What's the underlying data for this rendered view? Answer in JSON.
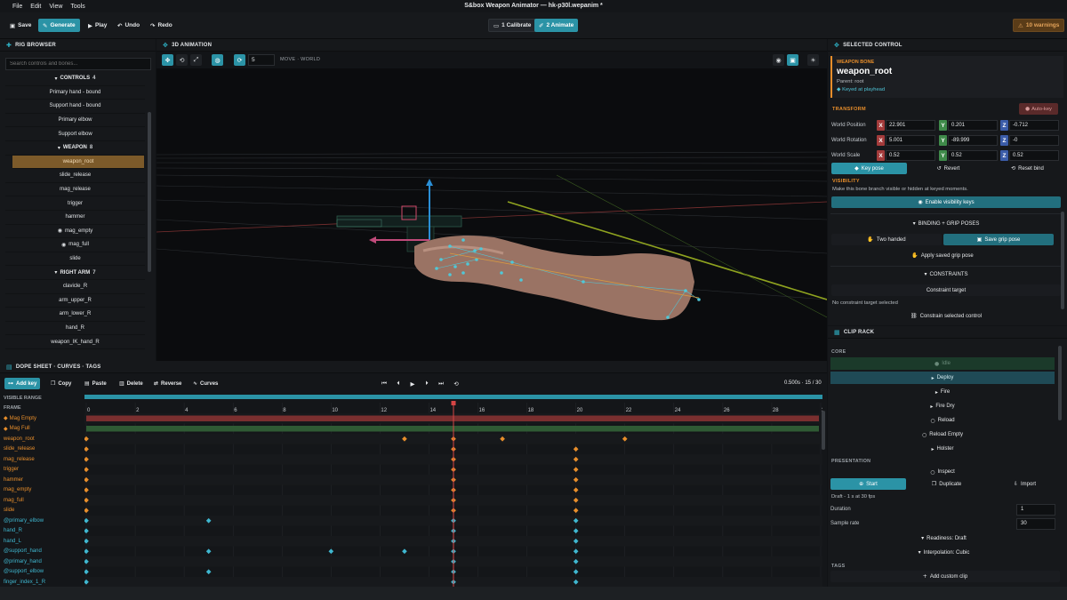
{
  "menu": [
    "File",
    "Edit",
    "View",
    "Tools"
  ],
  "window_title": "S&box Weapon Animator — hk-p30l.wepanim *",
  "toolbar": {
    "save": "Save",
    "generate": "Generate",
    "play": "Play",
    "undo": "Undo",
    "redo": "Redo",
    "calibrate": "1  Calibrate",
    "animate": "2  Animate",
    "warnings": "10 warnings"
  },
  "rig": {
    "title": "RIG BROWSER",
    "search_placeholder": "Search controls and bones...",
    "rows": [
      {
        "t": "group",
        "label": "CONTROLS",
        "count": "4"
      },
      {
        "t": "item",
        "label": "Primary hand - bound"
      },
      {
        "t": "item",
        "label": "Support hand - bound"
      },
      {
        "t": "item",
        "label": "Primary elbow"
      },
      {
        "t": "item",
        "label": "Support elbow"
      },
      {
        "t": "group",
        "label": "WEAPON",
        "count": "8"
      },
      {
        "t": "sel",
        "label": "weapon_root"
      },
      {
        "t": "item",
        "label": "slide_release"
      },
      {
        "t": "item",
        "label": "mag_release"
      },
      {
        "t": "item",
        "label": "trigger"
      },
      {
        "t": "item",
        "label": "hammer"
      },
      {
        "t": "eye",
        "label": "mag_empty"
      },
      {
        "t": "eye",
        "label": "mag_full"
      },
      {
        "t": "item",
        "label": "slide"
      },
      {
        "t": "group",
        "label": "RIGHT ARM",
        "count": "7"
      },
      {
        "t": "item",
        "label": "clavicle_R"
      },
      {
        "t": "item",
        "label": "arm_upper_R"
      },
      {
        "t": "item",
        "label": "arm_lower_R"
      },
      {
        "t": "item",
        "label": "hand_R"
      },
      {
        "t": "item",
        "label": "weapon_IK_hand_R"
      }
    ]
  },
  "viewport": {
    "title": "3D ANIMATION",
    "step": "5",
    "mode": "MOVE · WORLD"
  },
  "selected": {
    "title": "SELECTED CONTROL",
    "tag": "WEAPON BONE",
    "name": "weapon_root",
    "parent": "Parent: root",
    "keyed": "Keyed at playhead",
    "transform_label": "TRANSFORM",
    "autokey": "Auto-key",
    "rows": [
      {
        "label": "World Position",
        "x": "22.901",
        "y": "0.201",
        "z": "-0.712"
      },
      {
        "label": "World Rotation",
        "x": "5.001",
        "y": "-89.999",
        "z": "-0"
      },
      {
        "label": "World Scale",
        "x": "0.52",
        "y": "0.52",
        "z": "0.52"
      }
    ],
    "key_pose": "Key pose",
    "revert": "Revert",
    "reset_bind": "Reset bind",
    "visibility_label": "VISIBILITY",
    "visibility_desc": "Make this bone branch visible or hidden at keyed moments.",
    "enable_vis": "Enable visibility keys",
    "binding": "BINDING + GRIP POSES",
    "two_handed": "Two handed",
    "save_grip": "Save grip pose",
    "apply_grip": "Apply saved grip pose",
    "constraints": "CONSTRAINTS",
    "constraint_target": "Constraint target",
    "no_target": "No constraint target selected",
    "constrain": "Constrain selected control"
  },
  "cliprack": {
    "title": "CLIP RACK",
    "core": "CORE",
    "clips": [
      {
        "label": "Idle",
        "state": "disabled",
        "icon": "dot"
      },
      {
        "label": "Deploy",
        "state": "active",
        "icon": "chev"
      },
      {
        "label": "Fire",
        "state": "",
        "icon": "chev"
      },
      {
        "label": "Fire Dry",
        "state": "",
        "icon": "chev"
      },
      {
        "label": "Reload",
        "state": "",
        "icon": "ring"
      },
      {
        "label": "Reload Empty",
        "state": "",
        "icon": "ring"
      },
      {
        "label": "Holster",
        "state": "",
        "icon": "chev"
      }
    ],
    "presentation": "PRESENTATION",
    "inspect": "Inspect",
    "start": "Start",
    "duplicate": "Duplicate",
    "import": "Import",
    "draft": "Draft - 1 s at 30 fps",
    "duration_label": "Duration",
    "duration": "1",
    "sample_label": "Sample rate",
    "sample": "30",
    "readiness": "Readiness: Draft",
    "interpolation": "Interpolation: Cubic",
    "tags": "TAGS",
    "add_clip": "Add custom clip"
  },
  "dope": {
    "title": "DOPE SHEET · CURVES · TAGS",
    "add_key": "Add key",
    "copy": "Copy",
    "paste": "Paste",
    "delete": "Delete",
    "reverse": "Reverse",
    "curves": "Curves",
    "time": "0.500s · 15 / 30",
    "visible_range": "VISIBLE RANGE",
    "frame": "FRAME",
    "frames": [
      "0",
      "2",
      "4",
      "6",
      "8",
      "10",
      "12",
      "14",
      "16",
      "18",
      "20",
      "22",
      "24",
      "26",
      "28",
      "30"
    ],
    "playhead": 15,
    "max_frame": 30,
    "tracks": [
      {
        "name": "Mag Empty",
        "kind": "vis",
        "keys": [],
        "bar": "#7a2f2f"
      },
      {
        "name": "Mag Full",
        "kind": "vis",
        "keys": [],
        "bar": "#2f5a34"
      },
      {
        "name": "weapon_root",
        "kind": "bone",
        "keys": [
          0,
          13,
          15,
          17,
          22
        ]
      },
      {
        "name": "slide_release",
        "kind": "bone",
        "keys": [
          0,
          15,
          20
        ]
      },
      {
        "name": "mag_release",
        "kind": "bone",
        "keys": [
          0,
          15,
          20
        ]
      },
      {
        "name": "trigger",
        "kind": "bone",
        "keys": [
          0,
          15,
          20
        ]
      },
      {
        "name": "hammer",
        "kind": "bone",
        "keys": [
          0,
          15,
          20
        ]
      },
      {
        "name": "mag_empty",
        "kind": "bone",
        "keys": [
          0,
          15,
          20
        ]
      },
      {
        "name": "mag_full",
        "kind": "bone",
        "keys": [
          0,
          15,
          20
        ]
      },
      {
        "name": "slide",
        "kind": "bone",
        "keys": [
          0,
          15,
          20
        ]
      },
      {
        "name": "@primary_elbow",
        "kind": "ctl",
        "keys": [
          0,
          5,
          15,
          20
        ]
      },
      {
        "name": "hand_R",
        "kind": "ctl",
        "keys": [
          0,
          15,
          20
        ]
      },
      {
        "name": "hand_L",
        "kind": "ctl",
        "keys": [
          0,
          15,
          20
        ]
      },
      {
        "name": "@support_hand",
        "kind": "ctl",
        "keys": [
          0,
          5,
          10,
          13,
          15,
          20
        ]
      },
      {
        "name": "@primary_hand",
        "kind": "ctl",
        "keys": [
          0,
          15,
          20
        ]
      },
      {
        "name": "@support_elbow",
        "kind": "ctl",
        "keys": [
          0,
          5,
          15,
          20
        ]
      },
      {
        "name": "finger_index_1_R",
        "kind": "ctl",
        "keys": [
          0,
          15,
          20
        ]
      }
    ]
  },
  "colors": {
    "accent": "#2b93a6",
    "bone": "#e88e2b",
    "control": "#3fb7d0",
    "playhead": "#d64545"
  }
}
